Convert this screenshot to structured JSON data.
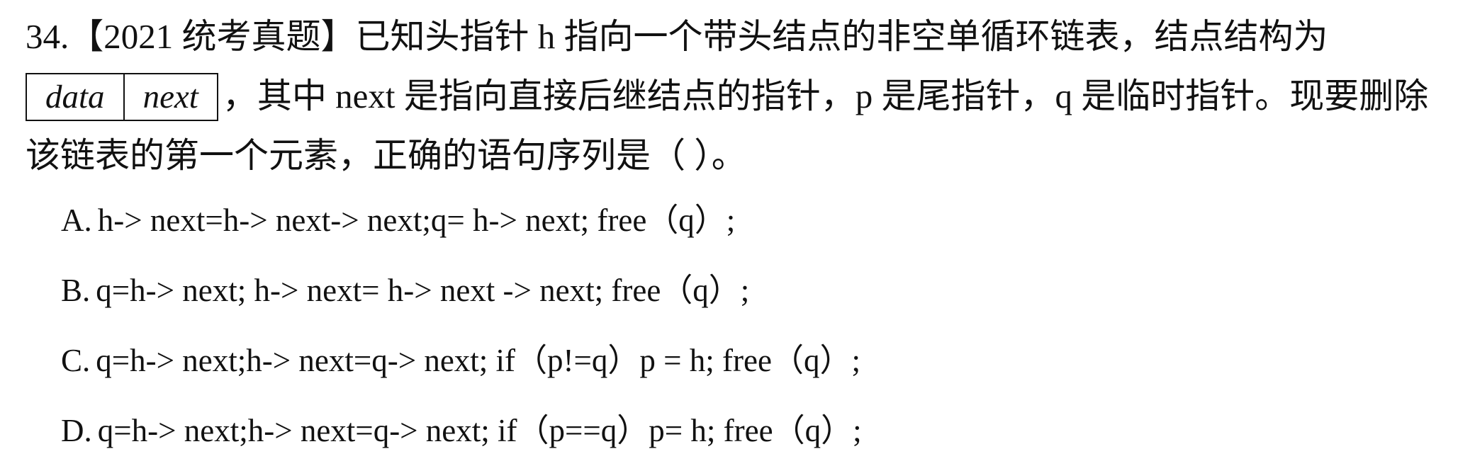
{
  "question": {
    "line1": "34.【2021  统考真题】已知头指针 h 指向一个带头结点的非空单循环链表，结点结构为",
    "node_fields": [
      "data",
      "next"
    ],
    "line2_rest": "，其中 next 是指向直接后继结点的指针，p 是尾指针，q 是临时指针。现要删除",
    "line3": "该链表的第一个元素，正确的语句序列是（      ）。"
  },
  "options": [
    {
      "letter": "A.",
      "text": "h-> next=h-> next-> next;q= h-> next; free（q）;"
    },
    {
      "letter": "B.",
      "text": "q=h-> next; h-> next= h-> next -> next; free（q）;"
    },
    {
      "letter": "C.",
      "text": "q=h-> next;h-> next=q-> next; if（p!=q）p = h; free（q）;"
    },
    {
      "letter": "D.",
      "text": "q=h-> next;h-> next=q-> next; if（p==q）p= h; free（q）;"
    }
  ]
}
